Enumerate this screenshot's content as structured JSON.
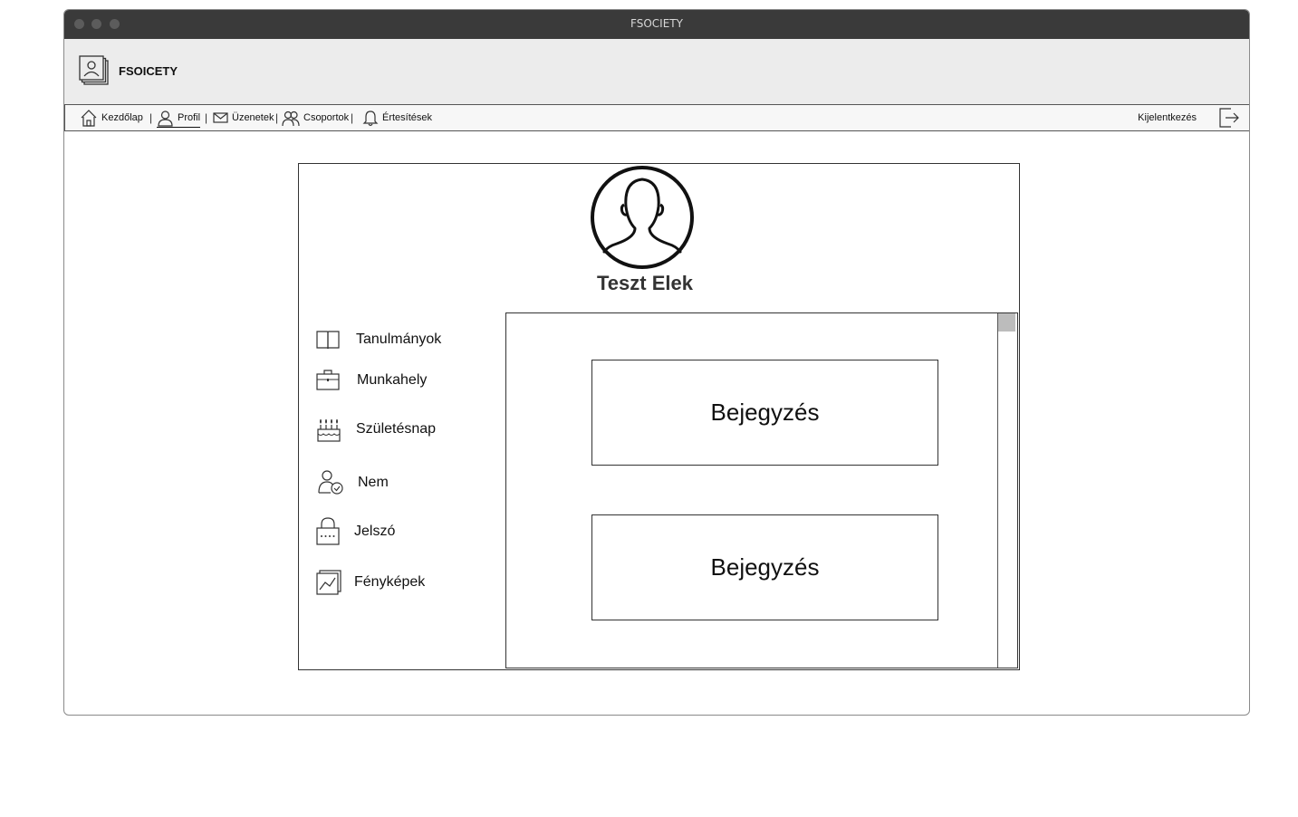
{
  "window": {
    "title": "FSOCIETY"
  },
  "header": {
    "app_name": "FSOICETY"
  },
  "nav": {
    "items": [
      {
        "label": "Kezdőlap",
        "icon": "home-icon"
      },
      {
        "label": "Profil",
        "icon": "user-icon",
        "active": true
      },
      {
        "label": "Üzenetek",
        "icon": "envelope-icon"
      },
      {
        "label": "Csoportok",
        "icon": "group-icon"
      },
      {
        "label": "Értesítések",
        "icon": "bell-icon"
      }
    ],
    "separator": "|",
    "logout_label": "Kijelentkezés",
    "logout_icon": "logout-icon"
  },
  "profile": {
    "name": "Teszt Elek",
    "avatar_icon": "avatar-icon",
    "sidebar": [
      {
        "label": "Tanulmányok",
        "icon": "book-icon"
      },
      {
        "label": "Munkahely",
        "icon": "briefcase-icon"
      },
      {
        "label": "Születésnap",
        "icon": "cake-icon"
      },
      {
        "label": "Nem",
        "icon": "user-check-icon"
      },
      {
        "label": "Jelszó",
        "icon": "lock-icon"
      },
      {
        "label": "Fényképek",
        "icon": "photo-icon"
      }
    ]
  },
  "feed": {
    "posts": [
      {
        "label": "Bejegyzés"
      },
      {
        "label": "Bejegyzés"
      }
    ]
  }
}
